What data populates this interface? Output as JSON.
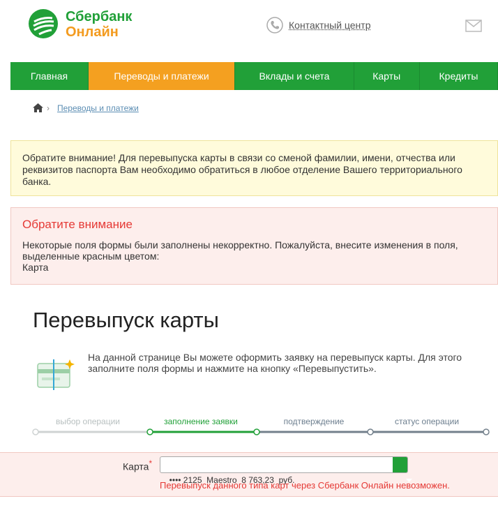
{
  "header": {
    "logo_line1": "Сбербанк",
    "logo_line2": "Онлайн",
    "contact_label": "Контактный центр",
    "brand_green": "#21a038",
    "brand_orange": "#f39b1f"
  },
  "nav": {
    "items": [
      {
        "label": "Главная",
        "active": false
      },
      {
        "label": "Переводы и платежи",
        "active": true
      },
      {
        "label": "Вклады и счета",
        "active": false
      },
      {
        "label": "Карты",
        "active": false
      },
      {
        "label": "Кредиты",
        "active": false
      }
    ]
  },
  "breadcrumb": {
    "icon": "home-icon",
    "link": "Переводы и платежи"
  },
  "notice": {
    "text": "Обратите внимание! Для перевыпуска карты в связи со сменой фамилии, имени, отчества или реквизитов паспорта Вам необходимо обратиться в любое отделение Вашего территориального банка."
  },
  "error": {
    "title": "Обратите внимание",
    "line1": "Некоторые поля формы были заполнены некорректно. Пожалуйста, внесите изменения в поля, выделенные красным цветом:",
    "field": "Карта",
    "color": "#e53935"
  },
  "page": {
    "title": "Перевыпуск карты",
    "description": "На данной странице Вы можете оформить заявку на перевыпуск карты. Для этого заполните поля формы и нажмите на кнопку «Перевыпустить»."
  },
  "steps": {
    "items": [
      {
        "label": "выбор операции",
        "state": "done"
      },
      {
        "label": "заполнение заявки",
        "state": "current"
      },
      {
        "label": "подтверждение",
        "state": "pending"
      },
      {
        "label": "статус операции",
        "state": "pending"
      }
    ]
  },
  "form": {
    "card_label": "Карта",
    "required_mark": "*",
    "card_value": "•••• 2125  Maestro  8 763,23  руб.",
    "card_error": "Перевыпуск данного типа карт через Сбербанк Онлайн невозможен."
  }
}
